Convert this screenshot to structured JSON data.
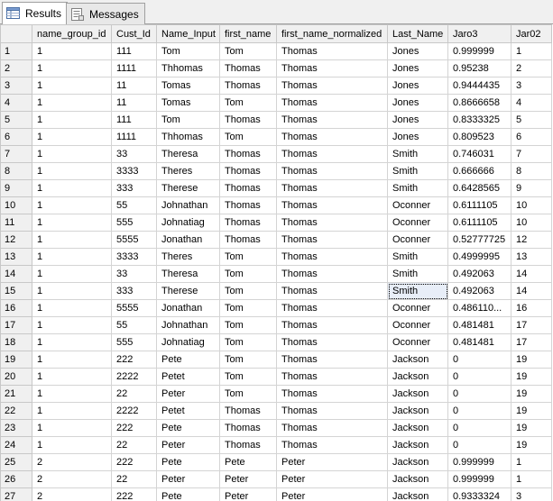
{
  "tabs": [
    {
      "label": "Results",
      "icon": "results-grid-icon",
      "active": true
    },
    {
      "label": "Messages",
      "icon": "messages-icon",
      "active": false
    }
  ],
  "columns": [
    "name_group_id",
    "Cust_Id",
    "Name_Input",
    "first_name",
    "first_name_normalized",
    "Last_Name",
    "Jaro3",
    "Jar02"
  ],
  "selected_cell": {
    "row": 15,
    "column": "Last_Name"
  },
  "rows": [
    [
      "1",
      "1",
      "111",
      "Tom",
      "Tom",
      "Thomas",
      "Jones",
      "0.999999",
      "1"
    ],
    [
      "2",
      "1",
      "1111",
      "Thhomas",
      "Thomas",
      "Thomas",
      "Jones",
      "0.95238",
      "2"
    ],
    [
      "3",
      "1",
      "11",
      "Tomas",
      "Thomas",
      "Thomas",
      "Jones",
      "0.9444435",
      "3"
    ],
    [
      "4",
      "1",
      "11",
      "Tomas",
      "Tom",
      "Thomas",
      "Jones",
      "0.8666658",
      "4"
    ],
    [
      "5",
      "1",
      "111",
      "Tom",
      "Thomas",
      "Thomas",
      "Jones",
      "0.8333325",
      "5"
    ],
    [
      "6",
      "1",
      "1111",
      "Thhomas",
      "Tom",
      "Thomas",
      "Jones",
      "0.809523",
      "6"
    ],
    [
      "7",
      "1",
      "33",
      "Theresa",
      "Thomas",
      "Thomas",
      "Smith",
      "0.746031",
      "7"
    ],
    [
      "8",
      "1",
      "3333",
      "Theres",
      "Thomas",
      "Thomas",
      "Smith",
      "0.666666",
      "8"
    ],
    [
      "9",
      "1",
      "333",
      "Therese",
      "Thomas",
      "Thomas",
      "Smith",
      "0.6428565",
      "9"
    ],
    [
      "10",
      "1",
      "55",
      "Johnathan",
      "Thomas",
      "Thomas",
      "Oconner",
      "0.6111105",
      "10"
    ],
    [
      "11",
      "1",
      "555",
      "Johnatiag",
      "Thomas",
      "Thomas",
      "Oconner",
      "0.6111105",
      "10"
    ],
    [
      "12",
      "1",
      "5555",
      "Jonathan",
      "Thomas",
      "Thomas",
      "Oconner",
      "0.52777725",
      "12"
    ],
    [
      "13",
      "1",
      "3333",
      "Theres",
      "Tom",
      "Thomas",
      "Smith",
      "0.4999995",
      "13"
    ],
    [
      "14",
      "1",
      "33",
      "Theresa",
      "Tom",
      "Thomas",
      "Smith",
      "0.492063",
      "14"
    ],
    [
      "15",
      "1",
      "333",
      "Therese",
      "Tom",
      "Thomas",
      "Smith",
      "0.492063",
      "14"
    ],
    [
      "16",
      "1",
      "5555",
      "Jonathan",
      "Tom",
      "Thomas",
      "Oconner",
      "0.486110...",
      "16"
    ],
    [
      "17",
      "1",
      "55",
      "Johnathan",
      "Tom",
      "Thomas",
      "Oconner",
      "0.481481",
      "17"
    ],
    [
      "18",
      "1",
      "555",
      "Johnatiag",
      "Tom",
      "Thomas",
      "Oconner",
      "0.481481",
      "17"
    ],
    [
      "19",
      "1",
      "222",
      "Pete",
      "Tom",
      "Thomas",
      "Jackson",
      "0",
      "19"
    ],
    [
      "20",
      "1",
      "2222",
      "Petet",
      "Tom",
      "Thomas",
      "Jackson",
      "0",
      "19"
    ],
    [
      "21",
      "1",
      "22",
      "Peter",
      "Tom",
      "Thomas",
      "Jackson",
      "0",
      "19"
    ],
    [
      "22",
      "1",
      "2222",
      "Petet",
      "Thomas",
      "Thomas",
      "Jackson",
      "0",
      "19"
    ],
    [
      "23",
      "1",
      "222",
      "Pete",
      "Thomas",
      "Thomas",
      "Jackson",
      "0",
      "19"
    ],
    [
      "24",
      "1",
      "22",
      "Peter",
      "Thomas",
      "Thomas",
      "Jackson",
      "0",
      "19"
    ],
    [
      "25",
      "2",
      "222",
      "Pete",
      "Pete",
      "Peter",
      "Jackson",
      "0.999999",
      "1"
    ],
    [
      "26",
      "2",
      "22",
      "Peter",
      "Peter",
      "Peter",
      "Jackson",
      "0.999999",
      "1"
    ],
    [
      "27",
      "2",
      "222",
      "Pete",
      "Peter",
      "Peter",
      "Jackson",
      "0.9333324",
      "3"
    ]
  ]
}
